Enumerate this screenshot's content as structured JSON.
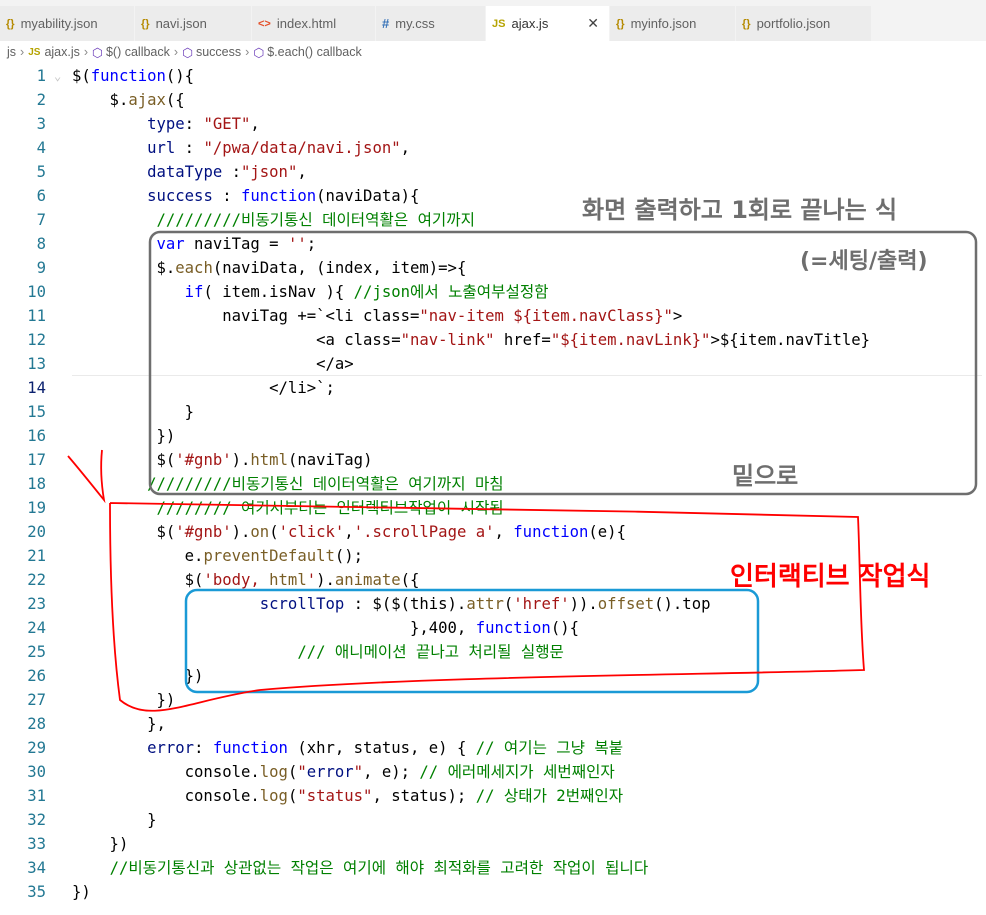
{
  "tabs": [
    {
      "icon": "{}",
      "label": "myability.json",
      "type": "json"
    },
    {
      "icon": "{}",
      "label": "navi.json",
      "type": "json"
    },
    {
      "icon": "<>",
      "label": "index.html",
      "type": "html"
    },
    {
      "icon": "#",
      "label": "my.css",
      "type": "css"
    },
    {
      "icon": "JS",
      "label": "ajax.js",
      "type": "js",
      "active": true,
      "close": "✕"
    },
    {
      "icon": "{}",
      "label": "myinfo.json",
      "type": "json"
    },
    {
      "icon": "{}",
      "label": "portfolio.json",
      "type": "json"
    }
  ],
  "breadcrumb": {
    "root": "js",
    "file_icon": "JS",
    "file": "ajax.js",
    "items": [
      "$() callback",
      "success",
      "$.each() callback"
    ]
  },
  "editor": {
    "current_line": 14,
    "lines": [
      "$(function(){",
      "    $.ajax({",
      "        type: \"GET\",",
      "        url : \"/pwa/data/navi.json\",",
      "        dataType :\"json\",",
      "        success : function(naviData){",
      "         /////////비동기통신 데이터역활은 여기까지",
      "         var naviTag = '';",
      "         $.each(naviData, (index, item)=>{",
      "            if( item.isNav ){ //json에서 노출여부설정함",
      "                naviTag +=`<li class=\"nav-item ${item.navClass}\">",
      "                          <a class=\"nav-link\" href=\"${item.navLink}\">${item.navTitle}",
      "                          </a>",
      "                     </li>`;",
      "            }",
      "         })",
      "         $('#gnb').html(naviTag)",
      "        /////////비동기통신 데이터역활은 여기까지 마침",
      "         //////// 여기서부터는 인터렉티브작업이 시작됨",
      "         $('#gnb').on('click','.scrollPage a', function(e){",
      "            e.preventDefault();",
      "            $('body, html').animate({",
      "                    scrollTop : $($(this).attr('href')).offset().top",
      "                                    },400, function(){",
      "                        /// 애니메이션 끝나고 처리될 실행문",
      "            })",
      "         })",
      "        },",
      "        error: function (xhr, status, e) { // 여기는 그냥 복붙",
      "            console.log(\"error\", e); // 에러메세지가 세번째인자",
      "            console.log(\"status\", status); // 상태가 2번째인자",
      "        }",
      "    })",
      "    //비동기통신과 상관없는 작업은 여기에 해야 최적화를 고려한 작업이 됩니다",
      "})"
    ]
  },
  "annotations": {
    "gray_title": "화면 출력하고 1회로 끝나는 식",
    "gray_sub": "(=세팅/출력)",
    "gray_bottom": "밑으로",
    "red_label": "인터랙티브 작업식"
  },
  "colors": {
    "gray": "#6e6e6e",
    "red": "#ff0000",
    "blue": "#1a9ad6"
  }
}
